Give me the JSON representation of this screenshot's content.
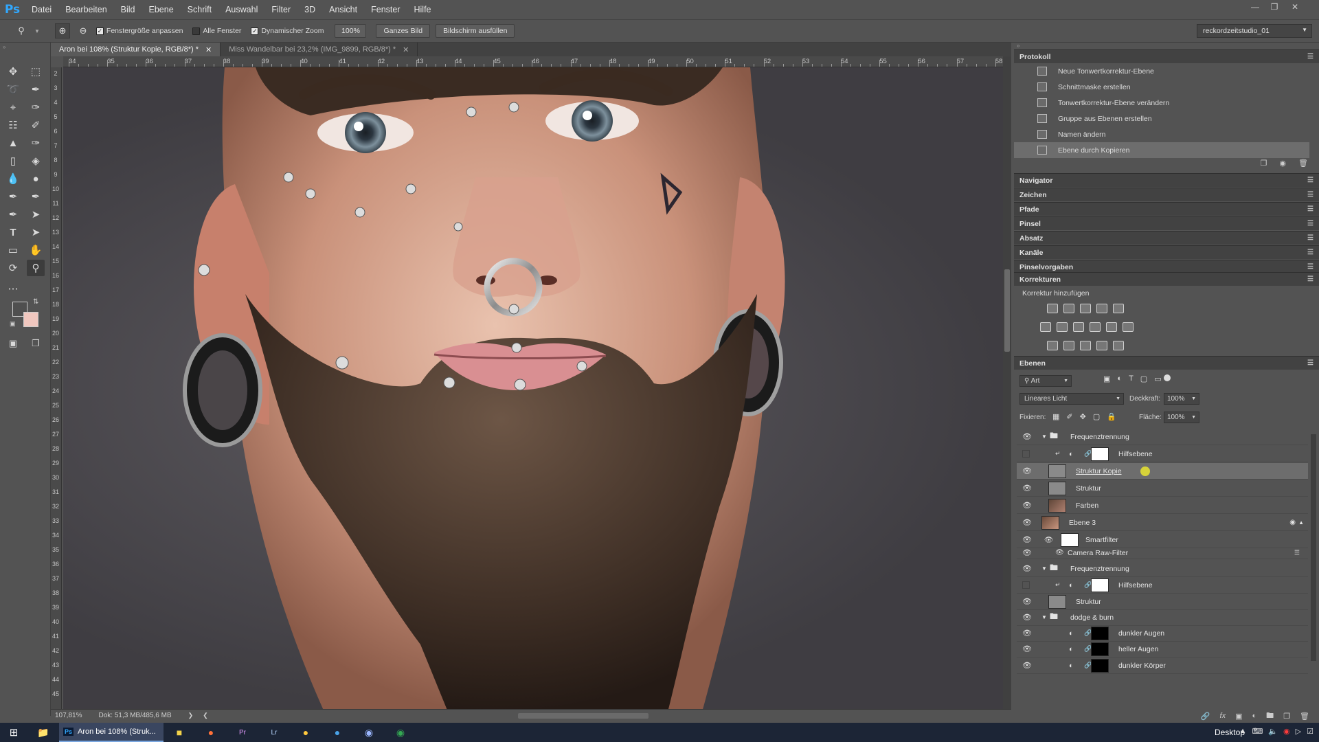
{
  "app": {
    "logo": "Ps"
  },
  "menu": [
    "Datei",
    "Bearbeiten",
    "Bild",
    "Ebene",
    "Schrift",
    "Auswahl",
    "Filter",
    "3D",
    "Ansicht",
    "Fenster",
    "Hilfe"
  ],
  "options": {
    "resize_windows": "Fenstergröße anpassen",
    "all_windows": "Alle Fenster",
    "scrubby_zoom": "Dynamischer Zoom",
    "zoom_value": "100%",
    "fit_screen": "Ganzes Bild",
    "fill_screen": "Bildschirm ausfüllen",
    "workspace": "reckordzeitstudio_01"
  },
  "tabs": [
    {
      "label": "Aron bei 108% (Struktur Kopie, RGB/8*) *",
      "active": true
    },
    {
      "label": "Miss Wandelbar bei 23,2% (IMG_9899, RGB/8*) *",
      "active": false
    }
  ],
  "ruler_h": [
    "34",
    "35",
    "36",
    "37",
    "38",
    "39",
    "40",
    "41",
    "42",
    "43",
    "44",
    "45",
    "46",
    "47",
    "48",
    "49",
    "50",
    "51",
    "52",
    "53",
    "54",
    "55",
    "56",
    "57",
    "58"
  ],
  "ruler_v": [
    "2",
    "3",
    "4",
    "5",
    "6",
    "7",
    "8",
    "9",
    "10",
    "11",
    "12",
    "13",
    "14",
    "15",
    "16",
    "17",
    "18",
    "19",
    "20",
    "21",
    "22",
    "23",
    "24",
    "25",
    "26",
    "27",
    "28",
    "29",
    "30",
    "31",
    "32",
    "33",
    "34",
    "35",
    "36",
    "37",
    "38",
    "39",
    "40",
    "41",
    "42",
    "43",
    "44",
    "45"
  ],
  "status": {
    "zoom": "107,81%",
    "doc": "Dok: 51,3 MB/485,6 MB"
  },
  "history": {
    "title": "Protokoll",
    "items": [
      {
        "label": "Neue Tonwertkorrektur-Ebene",
        "selected": false
      },
      {
        "label": "Schnittmaske erstellen",
        "selected": false
      },
      {
        "label": "Tonwertkorrektur-Ebene verändern",
        "selected": false
      },
      {
        "label": "Gruppe aus Ebenen erstellen",
        "selected": false
      },
      {
        "label": "Namen ändern",
        "selected": false
      },
      {
        "label": "Ebene durch Kopieren",
        "selected": true
      }
    ]
  },
  "collapsed_panels": [
    "Navigator",
    "Zeichen",
    "Pfade",
    "Pinsel",
    "Absatz",
    "Kanäle",
    "Pinselvorgaben"
  ],
  "adjustments": {
    "title": "Korrekturen",
    "subtitle": "Korrektur hinzufügen"
  },
  "layers": {
    "title": "Ebenen",
    "filter": "Art",
    "blend_mode": "Lineares Licht",
    "opacity_label": "Deckkraft:",
    "opacity": "100%",
    "lock_label": "Fixieren:",
    "fill_label": "Fläche:",
    "fill": "100%",
    "rows": [
      {
        "name": "Frequenztrennung",
        "type": "group",
        "visible": true,
        "selected": false
      },
      {
        "name": "Hilfsebene",
        "type": "adjustment",
        "visible": false,
        "selected": false
      },
      {
        "name": "Struktur Kopie",
        "type": "pixel",
        "visible": true,
        "selected": true
      },
      {
        "name": "Struktur",
        "type": "pixel",
        "visible": true,
        "selected": false
      },
      {
        "name": "Farben",
        "type": "pixel",
        "visible": true,
        "selected": false
      },
      {
        "name": "Ebene 3",
        "type": "smart",
        "visible": true,
        "selected": false
      },
      {
        "name": "Smartfilter",
        "type": "filter",
        "visible": true,
        "selected": false
      },
      {
        "name": "Camera Raw-Filter",
        "type": "filter-item",
        "visible": true,
        "selected": false
      },
      {
        "name": "Frequenztrennung",
        "type": "group",
        "visible": true,
        "selected": false
      },
      {
        "name": "Hilfsebene",
        "type": "adjustment",
        "visible": false,
        "selected": false
      },
      {
        "name": "Struktur",
        "type": "pixel",
        "visible": true,
        "selected": false
      },
      {
        "name": "dodge & burn",
        "type": "group",
        "visible": true,
        "selected": false
      },
      {
        "name": "dunkler Augen",
        "type": "adjustment-black",
        "visible": true,
        "selected": false
      },
      {
        "name": "heller Augen",
        "type": "adjustment-black",
        "visible": true,
        "selected": false
      },
      {
        "name": "dunkler Körper",
        "type": "adjustment-black",
        "visible": true,
        "selected": false
      }
    ]
  },
  "taskbar": {
    "active_app": "Aron bei 108% (Struk...",
    "desktop": "Desktop"
  },
  "colors": {
    "ps_blue": "#31a8ff",
    "panel_bg": "#535353",
    "taskbar_bg": "#1c2536"
  }
}
